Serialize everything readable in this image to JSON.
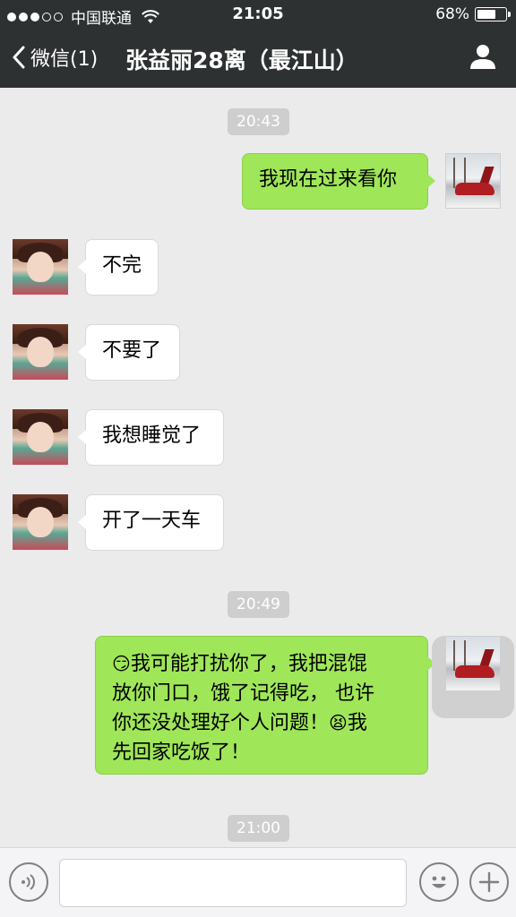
{
  "status_bar": {
    "carrier": "中国联通",
    "time": "21:05",
    "battery_percent": "68%",
    "battery_level": 0.68,
    "signal_bars_filled": 3,
    "signal_bars_total": 5
  },
  "nav": {
    "back_label": "微信(1)",
    "title": "张益丽28离（最江山）",
    "profile_icon": "person-icon"
  },
  "chat": {
    "timestamps": [
      "20:43",
      "20:49",
      "21:00"
    ],
    "messages": [
      {
        "direction": "out",
        "text": "我现在过来看你"
      },
      {
        "direction": "in",
        "text": "不完"
      },
      {
        "direction": "in",
        "text": "不要了"
      },
      {
        "direction": "in",
        "text": "我想睡觉了"
      },
      {
        "direction": "in",
        "text": "开了一天车"
      },
      {
        "direction": "out",
        "emoji_lead": "😏",
        "text_line1": "我可能打扰你了，我把混馄",
        "text_line2": "放你门口，饿了记得吃， 也许",
        "text_line3a": "你还没处理好个人问题！",
        "emoji_mid": "😫",
        "text_line3b": "我",
        "text_line4": "先回家吃饭了！"
      }
    ]
  },
  "input_bar": {
    "voice_icon": "voice-icon",
    "emoji_icon": "smiley-icon",
    "plus_icon": "plus-icon"
  },
  "colors": {
    "header_bg": "#2e3132",
    "chat_bg": "#ebebeb",
    "out_bubble": "#9fe658",
    "in_bubble": "#ffffff"
  }
}
